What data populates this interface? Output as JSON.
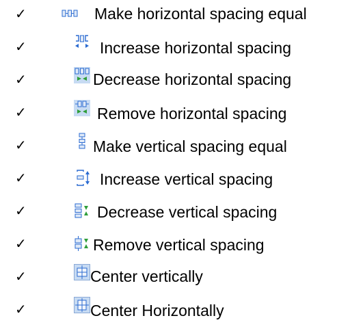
{
  "items": [
    {
      "check": "✓",
      "icon": "make-horizontal-spacing-equal-icon",
      "label": "Make horizontal spacing equal"
    },
    {
      "check": "✓",
      "icon": "increase-horizontal-spacing-icon",
      "label": "Increase horizontal spacing"
    },
    {
      "check": "✓",
      "icon": "decrease-horizontal-spacing-icon",
      "label": "Decrease horizontal spacing"
    },
    {
      "check": "✓",
      "icon": "remove-horizontal-spacing-icon",
      "label": "Remove horizontal spacing"
    },
    {
      "check": "✓",
      "icon": "make-vertical-spacing-equal-icon",
      "label": "Make vertical spacing equal"
    },
    {
      "check": "✓",
      "icon": "increase-vertical-spacing-icon",
      "label": "Increase vertical spacing"
    },
    {
      "check": "✓",
      "icon": "decrease-vertical-spacing-icon",
      "label": "Decrease vertical spacing"
    },
    {
      "check": "✓",
      "icon": "remove-vertical-spacing-icon",
      "label": "Remove vertical spacing"
    },
    {
      "check": "✓",
      "icon": "center-vertically-icon",
      "label": "Center vertically"
    },
    {
      "check": "✓",
      "icon": "center-horizontally-icon",
      "label": "Center Horizontally"
    }
  ],
  "colors": {
    "icon_blue": "#2a6ad1",
    "icon_green": "#2f9e3a",
    "icon_fill": "#dfe9f7",
    "icon_panel": "#c7dbf3"
  }
}
